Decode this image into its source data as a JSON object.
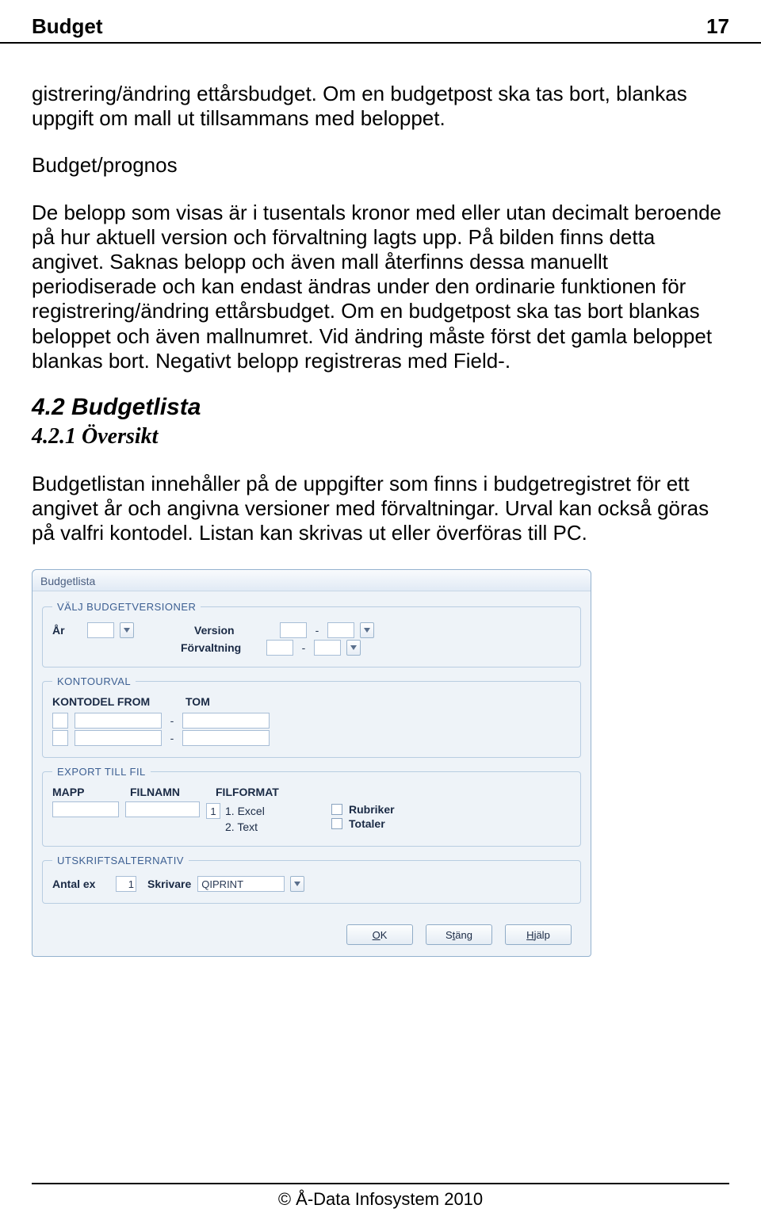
{
  "header": {
    "title": "Budget",
    "page": "17"
  },
  "body": {
    "p1": "gistrering/ändring ettårsbudget. Om en budgetpost ska tas bort, blankas uppgift om mall ut tillsammans med beloppet.",
    "sub1": "Budget/prognos",
    "p2": "De belopp som visas är i tusentals kronor med eller utan decimalt beroende på hur aktuell version och förvaltning lagts upp. På bilden finns detta angivet. Saknas belopp och även mall återfinns dessa manuellt periodiserade och kan endast ändras under den ordinarie funktionen för registrering/ändring ettårsbudget. Om en budgetpost ska tas bort blankas beloppet och även mallnumret. Vid ändring måste först det gamla beloppet blankas bort. Negativt belopp registreras med Field-.",
    "h42": "4.2 Budgetlista",
    "h421": "4.2.1 Översikt",
    "p3": "Budgetlistan innehåller på de uppgifter som finns i budgetregistret för ett angivet år och angivna versioner med förvaltningar. Urval kan också göras på valfri kontodel. Listan kan skrivas ut eller överföras till PC."
  },
  "dialog": {
    "title": "Budgetlista",
    "group1": {
      "legend": "VÄLJ BUDGETVERSIONER",
      "ar_label": "År",
      "version_label": "Version",
      "forvaltning_label": "Förvaltning"
    },
    "group2": {
      "legend": "KONTOURVAL",
      "from": "KONTODEL FROM",
      "tom": "TOM"
    },
    "group3": {
      "legend": "EXPORT TILL FIL",
      "mapp": "MAPP",
      "filnamn": "FILNAMN",
      "filformat": "FILFORMAT",
      "fmt1_num": "1",
      "fmt1": "1. Excel",
      "fmt2": "2. Text",
      "rubriker": "Rubriker",
      "totaler": "Totaler"
    },
    "group4": {
      "legend": "UTSKRIFTSALTERNATIV",
      "antal": "Antal ex",
      "antal_val": "1",
      "skrivare": "Skrivare",
      "skrivare_val": "QIPRINT"
    },
    "buttons": {
      "ok_u": "O",
      "ok_rest": "K",
      "stang_pre": "S",
      "stang_u": "t",
      "stang_post": "äng",
      "hjalp_u": "H",
      "hjalp_post": "jälp"
    }
  },
  "footer": {
    "copyright": "© Å-Data Infosystem 2010"
  }
}
